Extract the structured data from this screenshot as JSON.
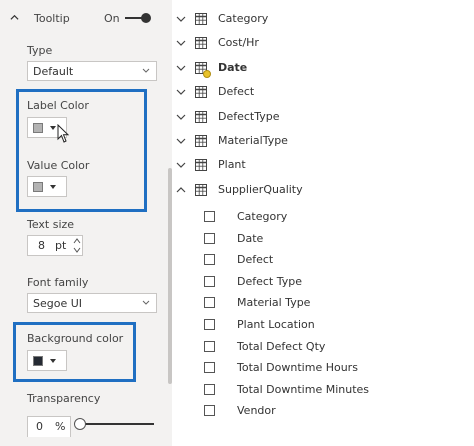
{
  "tooltip": {
    "title": "Tooltip",
    "toggle_label": "On",
    "type_label": "Type",
    "type_value": "Default",
    "label_color_label": "Label Color",
    "value_color_label": "Value Color",
    "text_size_label": "Text size",
    "text_size_value": "8",
    "text_size_unit": "pt",
    "font_family_label": "Font family",
    "font_family_value": "Segoe UI",
    "background_color_label": "Background color",
    "transparency_label": "Transparency",
    "transparency_value": "0",
    "transparency_unit": "%",
    "label_color_swatch": "#b3b3b3",
    "value_color_swatch": "#b3b3b3",
    "background_color_swatch": "#252a33"
  },
  "colors": {
    "highlight": "#1f6fc2",
    "pane_bg": "#f3f2f1",
    "date_badge": "#e8c22a"
  },
  "fields": {
    "tables": [
      {
        "name": "Category",
        "expanded": false,
        "bold": false
      },
      {
        "name": "Cost/Hr",
        "expanded": false,
        "bold": false
      },
      {
        "name": "Date",
        "expanded": false,
        "bold": true
      },
      {
        "name": "Defect",
        "expanded": false,
        "bold": false
      },
      {
        "name": "DefectType",
        "expanded": false,
        "bold": false
      },
      {
        "name": "MaterialType",
        "expanded": false,
        "bold": false
      },
      {
        "name": "Plant",
        "expanded": false,
        "bold": false
      },
      {
        "name": "SupplierQuality",
        "expanded": true,
        "bold": false
      }
    ],
    "supplier_quality_fields": [
      "Category",
      "Date",
      "Defect",
      "Defect Type",
      "Material Type",
      "Plant Location",
      "Total Defect Qty",
      "Total Downtime Hours",
      "Total Downtime Minutes",
      "Vendor"
    ],
    "icons": {
      "collapsed": "chevron-down-icon",
      "expanded": "chevron-up-icon",
      "table": "table-icon",
      "checkbox": "checkbox-icon"
    }
  }
}
